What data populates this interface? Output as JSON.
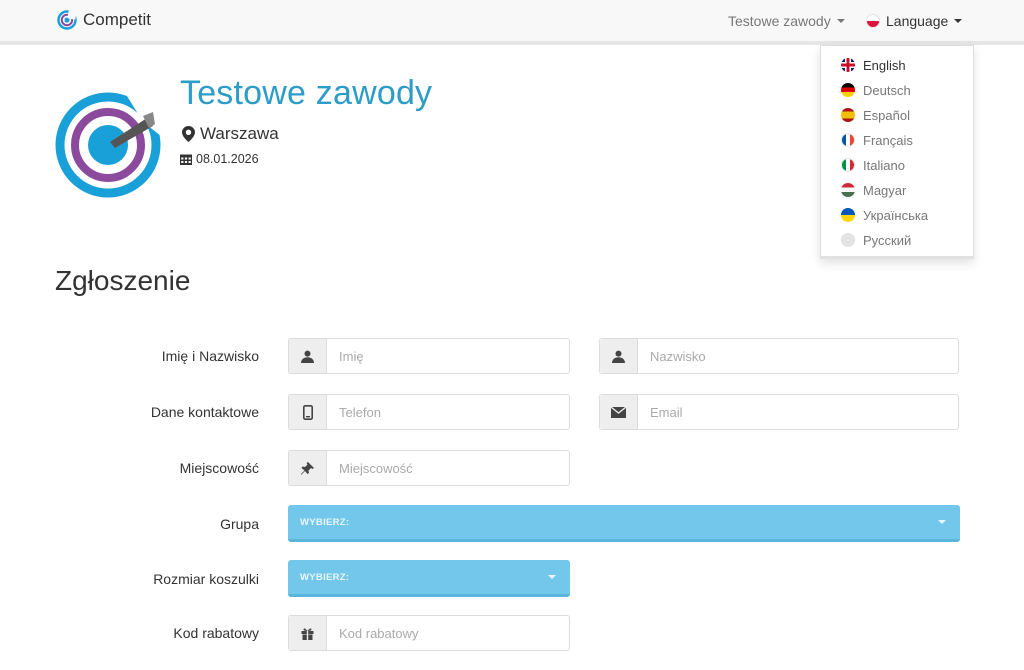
{
  "navbar": {
    "brand": "Competit",
    "event_menu": "Testowe zawody",
    "language_menu": "Language"
  },
  "languages": [
    {
      "label": "English",
      "flag": "gb",
      "active": true
    },
    {
      "label": "Deutsch",
      "flag": "de"
    },
    {
      "label": "Español",
      "flag": "es"
    },
    {
      "label": "Français",
      "flag": "fr"
    },
    {
      "label": "Italiano",
      "flag": "it"
    },
    {
      "label": "Magyar",
      "flag": "hu"
    },
    {
      "label": "Українська",
      "flag": "ua"
    },
    {
      "label": "Русский",
      "flag": "ru"
    }
  ],
  "event": {
    "title": "Testowe zawody",
    "city": "Warszawa",
    "date": "08.01.2026"
  },
  "section_title": "Zgłoszenie",
  "form": {
    "name_label": "Imię i Nazwisko",
    "first_name_placeholder": "Imię",
    "last_name_placeholder": "Nazwisko",
    "contact_label": "Dane kontaktowe",
    "phone_placeholder": "Telefon",
    "email_placeholder": "Email",
    "city_label": "Miejscowość",
    "city_placeholder": "Miejscowość",
    "group_label": "Grupa",
    "group_value": "WYBIERZ:",
    "shirt_label": "Rozmiar koszulki",
    "shirt_value": "WYBIERZ:",
    "discount_label": "Kod rabatowy",
    "discount_placeholder": "Kod rabatowy"
  },
  "colors": {
    "accent": "#2d9dc8",
    "select_bg": "#72c7ea",
    "logo_blue": "#1aa0d8",
    "logo_purple": "#8b4a9c"
  }
}
